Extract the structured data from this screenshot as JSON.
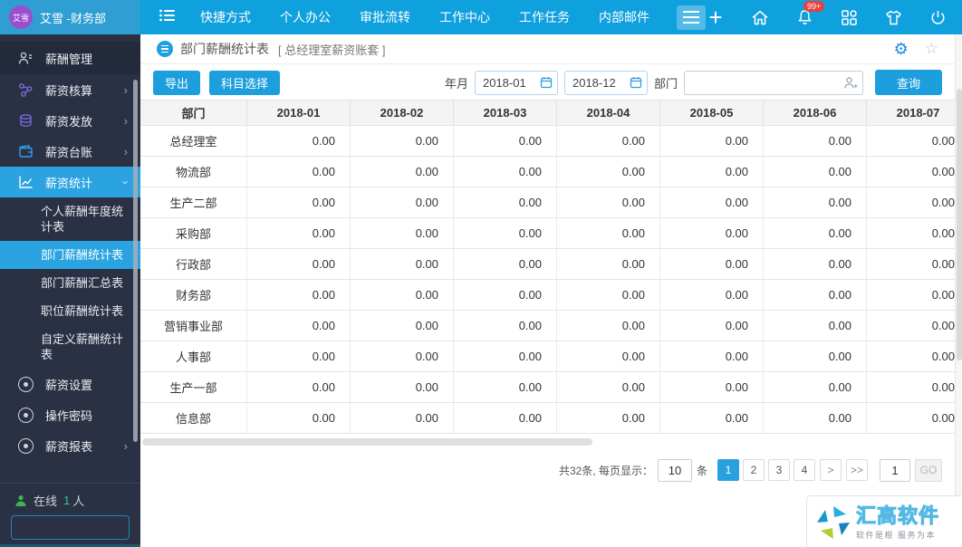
{
  "colors": {
    "accent": "#1e9fdd",
    "topbar": "#0fa0de",
    "logo_area": "#2f9ed2",
    "sidebar": "#2b3144",
    "selected_blue": "#2aa3e0",
    "badge_red": "#e64040",
    "online_green": "#3db54a"
  },
  "icons": {
    "chevron_right": "›",
    "gear": "⚙",
    "star": "☆",
    "plus": "+"
  },
  "topbar": {
    "logo_avatar": "艾雪",
    "user_label": "艾雪 -财务部",
    "menu": [
      "快捷方式",
      "个人办公",
      "审批流转",
      "工作中心",
      "工作任务",
      "内部邮件"
    ],
    "notification_badge": "99+"
  },
  "sidebar": {
    "header": "薪酬管理",
    "groups": [
      "薪资核算",
      "薪资发放",
      "薪资台账",
      "薪资统计"
    ],
    "sub_items": [
      "个人薪酬年度统计表",
      "部门薪酬统计表",
      "部门薪酬汇总表",
      "职位薪酬统计表",
      "自定义薪酬统计表"
    ],
    "active_sub_item": "部门薪酬统计表",
    "footer_items": [
      "薪资设置",
      "操作密码",
      "薪资报表"
    ],
    "online_label": "在线",
    "online_count": "1",
    "online_unit": "人",
    "search_placeholder": ""
  },
  "page": {
    "title": "部门薪酬统计表",
    "subtitle": "[ 总经理室薪资账套 ]"
  },
  "toolbar": {
    "export_label": "导出",
    "subject_select_label": "科目选择",
    "date_label": "年月",
    "date_from": "2018-01",
    "date_to": "2018-12",
    "dept_label": "部门",
    "dept_value": "",
    "query_label": "查询"
  },
  "table": {
    "columns": [
      "部门",
      "2018-01",
      "2018-02",
      "2018-03",
      "2018-04",
      "2018-05",
      "2018-06",
      "2018-07"
    ],
    "rows": [
      {
        "name": "总经理室",
        "values": [
          "0.00",
          "0.00",
          "0.00",
          "0.00",
          "0.00",
          "0.00",
          "0.00"
        ]
      },
      {
        "name": "物流部",
        "values": [
          "0.00",
          "0.00",
          "0.00",
          "0.00",
          "0.00",
          "0.00",
          "0.00"
        ]
      },
      {
        "name": "生产二部",
        "values": [
          "0.00",
          "0.00",
          "0.00",
          "0.00",
          "0.00",
          "0.00",
          "0.00"
        ]
      },
      {
        "name": "采购部",
        "values": [
          "0.00",
          "0.00",
          "0.00",
          "0.00",
          "0.00",
          "0.00",
          "0.00"
        ]
      },
      {
        "name": "行政部",
        "values": [
          "0.00",
          "0.00",
          "0.00",
          "0.00",
          "0.00",
          "0.00",
          "0.00"
        ]
      },
      {
        "name": "财务部",
        "values": [
          "0.00",
          "0.00",
          "0.00",
          "0.00",
          "0.00",
          "0.00",
          "0.00"
        ]
      },
      {
        "name": "营销事业部",
        "values": [
          "0.00",
          "0.00",
          "0.00",
          "0.00",
          "0.00",
          "0.00",
          "0.00"
        ]
      },
      {
        "name": "人事部",
        "values": [
          "0.00",
          "0.00",
          "0.00",
          "0.00",
          "0.00",
          "0.00",
          "0.00"
        ]
      },
      {
        "name": "生产一部",
        "values": [
          "0.00",
          "0.00",
          "0.00",
          "0.00",
          "0.00",
          "0.00",
          "0.00"
        ]
      },
      {
        "name": "信息部",
        "values": [
          "0.00",
          "0.00",
          "0.00",
          "0.00",
          "0.00",
          "0.00",
          "0.00"
        ]
      }
    ]
  },
  "pagination": {
    "total_text": "共32条, 每页显示：",
    "page_size": "10",
    "unit": "条",
    "pages": [
      "1",
      "2",
      "3",
      "4"
    ],
    "active_page": "1",
    "next": ">",
    "last": ">>",
    "goto_value": "1",
    "go_label": "GO"
  },
  "watermark": {
    "brand": "汇高软件",
    "slogan": "软件是根 服务为本"
  }
}
